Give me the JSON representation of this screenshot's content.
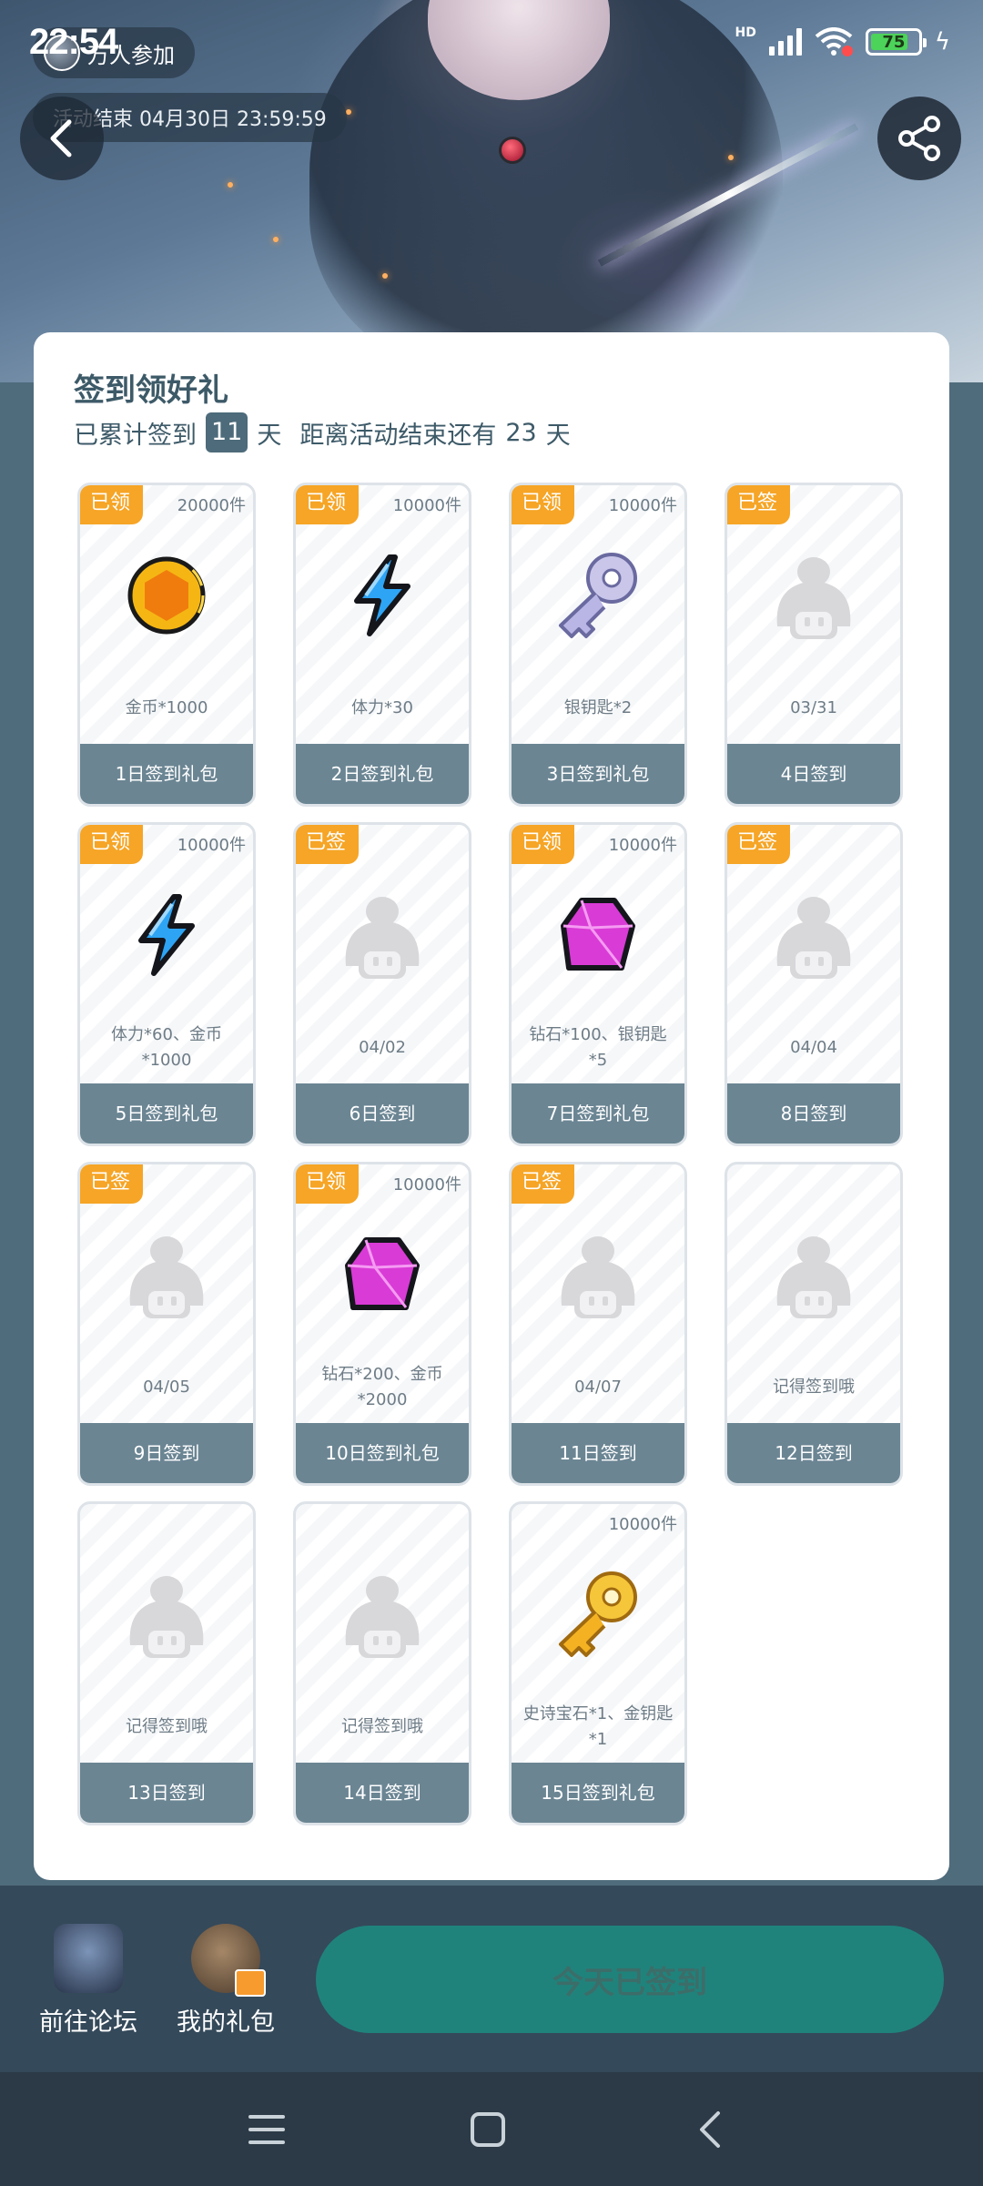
{
  "status_bar": {
    "time": "22:54",
    "hd": "HD",
    "battery": "75"
  },
  "hero": {
    "participants": "万人参加",
    "end_time": "活动结束 04月30日 23:59:59"
  },
  "card": {
    "title": "签到领好礼",
    "accumulated_prefix": "已累计签到",
    "accumulated_days": "11",
    "day_unit": "天",
    "remaining_prefix": "距离活动结束还有",
    "remaining_days": "23",
    "remaining_unit": "天"
  },
  "tiles": [
    {
      "badge": "已领",
      "qty": "20000件",
      "icon": "gold-coin",
      "desc": "金币*1000",
      "label": "1日签到礼包"
    },
    {
      "badge": "已领",
      "qty": "10000件",
      "icon": "lightning-bolt",
      "desc": "体力*30",
      "label": "2日签到礼包"
    },
    {
      "badge": "已领",
      "qty": "10000件",
      "icon": "silver-key",
      "desc": "银钥匙*2",
      "label": "3日签到礼包"
    },
    {
      "badge": "已签",
      "qty": "",
      "icon": "placeholder-character",
      "desc": "03/31",
      "label": "4日签到"
    },
    {
      "badge": "已领",
      "qty": "10000件",
      "icon": "lightning-bolt",
      "desc": "体力*60、金币*1000",
      "label": "5日签到礼包"
    },
    {
      "badge": "已签",
      "qty": "",
      "icon": "placeholder-character",
      "desc": "04/02",
      "label": "6日签到"
    },
    {
      "badge": "已领",
      "qty": "10000件",
      "icon": "diamond-gem",
      "desc": "钻石*100、银钥匙*5",
      "label": "7日签到礼包"
    },
    {
      "badge": "已签",
      "qty": "",
      "icon": "placeholder-character",
      "desc": "04/04",
      "label": "8日签到"
    },
    {
      "badge": "已签",
      "qty": "",
      "icon": "placeholder-character",
      "desc": "04/05",
      "label": "9日签到"
    },
    {
      "badge": "已领",
      "qty": "10000件",
      "icon": "diamond-gem",
      "desc": "钻石*200、金币*2000",
      "label": "10日签到礼包"
    },
    {
      "badge": "已签",
      "qty": "",
      "icon": "placeholder-character",
      "desc": "04/07",
      "label": "11日签到"
    },
    {
      "badge": "",
      "qty": "",
      "icon": "placeholder-character",
      "desc": "记得签到哦",
      "label": "12日签到"
    },
    {
      "badge": "",
      "qty": "",
      "icon": "placeholder-character",
      "desc": "记得签到哦",
      "label": "13日签到"
    },
    {
      "badge": "",
      "qty": "",
      "icon": "placeholder-character",
      "desc": "记得签到哦",
      "label": "14日签到"
    },
    {
      "badge": "",
      "qty": "10000件",
      "icon": "gold-key",
      "desc": "史诗宝石*1、金钥匙*1",
      "label": "15日签到礼包"
    }
  ],
  "bottom": {
    "forum": "前往论坛",
    "gifts": "我的礼包",
    "signed": "今天已签到"
  },
  "colors": {
    "badge": "#f6a526",
    "tile_footer": "#6b8593",
    "primary_button": "#1f837c",
    "page_bg": "#4f6c7c"
  }
}
